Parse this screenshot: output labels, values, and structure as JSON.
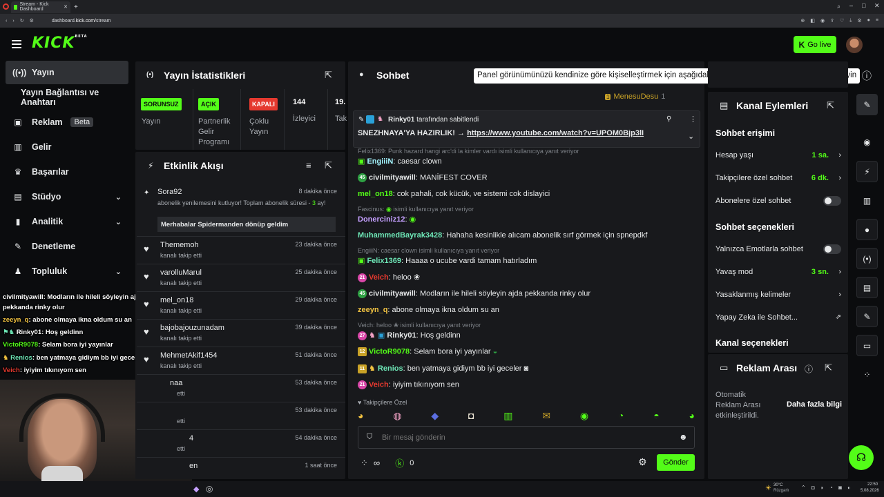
{
  "browser": {
    "tab_title": "Stream - Kick Dashboard",
    "url_prefix": "dashboard.",
    "url_domain": "kick.com",
    "url_path": "/stream"
  },
  "header": {
    "logo": "KICK",
    "logo_badge": "BETA",
    "go_live": "Go live"
  },
  "nav": {
    "items": [
      {
        "label": "Yayın",
        "icon": "broadcast-icon"
      },
      {
        "label": "Yayın Bağlantısı ve Anahtarı"
      },
      {
        "label": "Reklam",
        "badge": "Beta",
        "icon": "ad-icon"
      },
      {
        "label": "Gelir",
        "icon": "revenue-icon"
      },
      {
        "label": "Başarılar",
        "icon": "trophy-icon"
      },
      {
        "label": "Stüdyo",
        "icon": "studio-icon"
      },
      {
        "label": "Analitik",
        "icon": "analytics-icon"
      },
      {
        "label": "Denetleme",
        "icon": "wrench-icon"
      },
      {
        "label": "Topluluk",
        "icon": "community-icon"
      }
    ]
  },
  "stats": {
    "title": "Yayın İstatistikleri",
    "items": [
      {
        "tag": "SORUNSUZ",
        "label": "Yayın",
        "color": "#53fc18"
      },
      {
        "tag": "AÇIK",
        "label": "Partnerlik Gelir Programı",
        "color": "#53fc18"
      },
      {
        "tag": "KAPALI",
        "label": "Çoklu Yayın",
        "color": "#e5392f"
      },
      {
        "num": "144",
        "label": "İzleyici"
      },
      {
        "num": "19.",
        "label": "Tak"
      }
    ]
  },
  "activity": {
    "title": "Etkinlik Akışı",
    "first": {
      "name": "Sora92",
      "time": "8 dakika önce",
      "text_a": "abonelik yenilemesini kutluyor! Toplam abonelik süresi - ",
      "text_num": "3",
      "text_b": "ay!",
      "note": "Merhabalar Spidermanden dönüp geldim"
    },
    "rows": [
      {
        "name": "Thememoh",
        "action": "kanalı takip etti",
        "time": "23 dakika önce"
      },
      {
        "name": "varolluMarul",
        "action": "kanalı takip etti",
        "time": "25 dakika önce"
      },
      {
        "name": "mel_on18",
        "action": "kanalı takip etti",
        "time": "29 dakika önce"
      },
      {
        "name": "bajobajouzunadam",
        "action": "kanalı takip etti",
        "time": "39 dakika önce"
      },
      {
        "name": "MehmetAkif1454",
        "action": "kanalı takip etti",
        "time": "51 dakika önce"
      },
      {
        "name": "naa",
        "action": "etti",
        "time": "53 dakika önce"
      },
      {
        "name": "",
        "action": "etti",
        "time": "53 dakika önce"
      },
      {
        "name": "4",
        "action": "etti",
        "time": "54 dakika önce"
      },
      {
        "name": "en",
        "action": "",
        "time": "1 saat önce"
      }
    ]
  },
  "chat": {
    "title": "Sohbet",
    "tooltip": "Panel görünümünüzü kendinize göre kişiselleştirmek için aşağıdaki ekran araçlarına tıklayın veya sürükleyin",
    "top_user": "MenesuDesu",
    "top_count": "1",
    "pinned_by_user": "Rinky01",
    "pinned_by_text": "tarafından sabitlendi",
    "pinned_msg": "SNEZHNAYA'YA HAZIRLIK! → ",
    "pinned_link": "https://www.youtube.com/watch?v=UPOM0Bjp3lI",
    "reply_faded": "Felix1369: Punk hazard hangi arc'di la kimler vardı isimli kullanıcıya yanıt veriyor",
    "messages": [
      {
        "type": "msg",
        "user": "EngiiiN",
        "color": "#a4f5ff",
        "text": "caesar clown"
      },
      {
        "type": "msg",
        "lvl": "45",
        "lvlc": "#2ea043",
        "user": "civilmityawill",
        "color": "#ffffff",
        "text": "MANİFEST COVER"
      },
      {
        "type": "msg",
        "user": "mel_on18",
        "color": "#53fc18",
        "text": "cok pahali, cok kücük, ve sistemi cok dislayici"
      },
      {
        "type": "reply",
        "text": "Fascinus:",
        "text2": "isimli kullanıcıya yanıt veriyor"
      },
      {
        "type": "msg",
        "user": "Donerciniz12",
        "color": "#c5a0ff",
        "text": ""
      },
      {
        "type": "msg",
        "user": "MuhammedBayrak3428",
        "color": "#6ee7b7",
        "text": "Hahaha kesinlikle alıcam abonelik sırf görmek için spnepdkf"
      },
      {
        "type": "reply",
        "text": "EngiiiN: caesar clown isimli kullanıcıya yanıt veriyor",
        "text2": ""
      },
      {
        "type": "msg",
        "user": "Felix1369",
        "color": "#6ee7b7",
        "text": "Haaaa o ucube vardi tamam hatırladım"
      },
      {
        "type": "msg",
        "lvl": "21",
        "lvlc": "#d946a8",
        "user": "Veich",
        "color": "#e5392f",
        "text": "heloo"
      },
      {
        "type": "msg",
        "lvl": "45",
        "lvlc": "#2ea043",
        "user": "civilmityawill",
        "color": "#ffffff",
        "text": "Modların ile hileli söyleyin ajda pekkanda rinky olur"
      },
      {
        "type": "msg",
        "user": "zeeyn_q",
        "color": "#f5c542",
        "text": "abone olmaya ikna oldum su an"
      },
      {
        "type": "reply",
        "text": "Veich: heloo",
        "text2": "isimli kullanıcıya yanıt veriyor"
      },
      {
        "type": "msg",
        "lvl": "27",
        "lvlc": "#d946a8",
        "user": "Rinky01",
        "color": "#ffffff",
        "text": "Hoş geldinn"
      },
      {
        "type": "msg",
        "lvl": "12",
        "lvlc": "#c9a227",
        "user": "VictoR9078",
        "color": "#53fc18",
        "text": "Selam bora iyi yayınlar"
      },
      {
        "type": "msg",
        "lvl": "11",
        "lvlc": "#c9a227",
        "user": "Renios",
        "color": "#6ee7b7",
        "text": "ben yatmaya gidiym bb iyi geceler"
      },
      {
        "type": "msg",
        "lvl": "21",
        "lvlc": "#d946a8",
        "user": "Veich",
        "color": "#e5392f",
        "text": "iyiyim tıkınıyom sen"
      }
    ],
    "followers_label": "Takipçilere Özel",
    "input_placeholder": "Bir mesaj gönderin",
    "viewers_symbol": "∞",
    "kick_count": "0",
    "send": "Gönder"
  },
  "actions": {
    "title": "Kanal Eylemleri",
    "chat_access": "Sohbet erişimi",
    "rows1": [
      {
        "label": "Hesap yaşı",
        "value": "1 sa."
      },
      {
        "label": "Takipçilere özel sohbet",
        "value": "6 dk."
      },
      {
        "label": "Abonelere özel sohbet"
      }
    ],
    "chat_options": "Sohbet seçenekleri",
    "rows2": [
      {
        "label": "Yalnızca Emotlarla sohbet"
      },
      {
        "label": "Yavaş mod",
        "value": "3 sn."
      },
      {
        "label": "Yasaklanmış kelimeler"
      },
      {
        "label": "Yapay Zeka ile Sohbet..."
      }
    ],
    "channel_options": "Kanal seçenekleri"
  },
  "ads": {
    "title": "Reklam Arası",
    "text": "Otomatik Reklam Arası etkinleştirildi.",
    "more": "Daha fazla bilgi"
  },
  "overlay": [
    {
      "user": "civilmityawill",
      "color": "#ffffff",
      "text": ": Modların ile hileli söyleyin ajda"
    },
    {
      "user": "",
      "color": "#ffffff",
      "text": "pekkanda rinky olur"
    },
    {
      "user": "zeeyn_q",
      "color": "#f5c542",
      "text": ": abone olmaya ikna oldum su an"
    },
    {
      "user": "Rinky01",
      "color": "#ffffff",
      "text": ": Hoş geldinn"
    },
    {
      "user": "VictoR9078",
      "color": "#53fc18",
      "text": ": Selam bora iyi yayınlar"
    },
    {
      "user": "Renios",
      "color": "#6ee7b7",
      "text": ": ben yatmaya gidiym bb iyi geceler"
    },
    {
      "user": "Veich",
      "color": "#e5392f",
      "text": ": iyiyim tıkınıyom sen"
    }
  ],
  "taskbar": {
    "weather": "30°C",
    "weather_sub": "Rüzgarlı",
    "time": "22:50",
    "date": "5.08.2026"
  }
}
